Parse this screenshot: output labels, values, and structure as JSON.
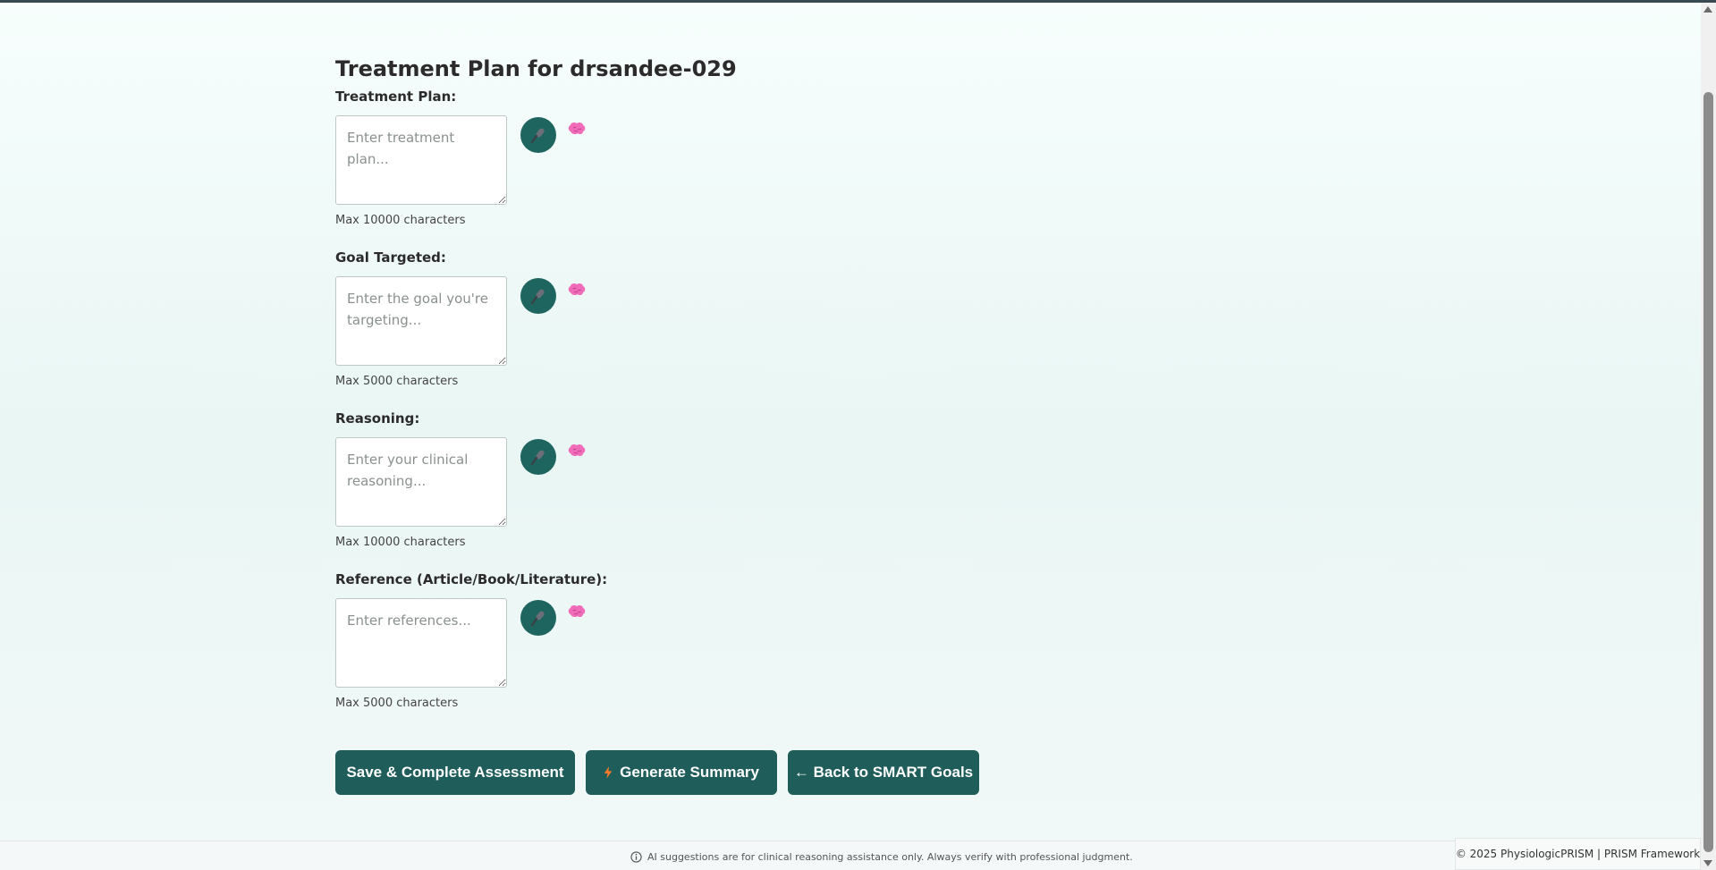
{
  "page": {
    "title": "Treatment Plan for drsandee-029"
  },
  "fields": [
    {
      "label": "Treatment Plan:",
      "placeholder": "Enter treatment plan...",
      "value": "",
      "hint": "Max 10000 characters"
    },
    {
      "label": "Goal Targeted:",
      "placeholder": "Enter the goal you're targeting...",
      "value": "",
      "hint": "Max 5000 characters"
    },
    {
      "label": "Reasoning:",
      "placeholder": "Enter your clinical reasoning...",
      "value": "",
      "hint": "Max 10000 characters"
    },
    {
      "label": "Reference (Article/Book/Literature):",
      "placeholder": "Enter references...",
      "value": "",
      "hint": "Max 5000 characters"
    }
  ],
  "icons": {
    "mic": "microphone-icon",
    "brain": "brain-icon",
    "lightning": "lightning-icon",
    "info": "info-icon"
  },
  "actions": {
    "save_label": "Save & Complete Assessment",
    "summary_label": "Generate Summary",
    "back_label": "← Back to SMART Goals"
  },
  "footer": {
    "disclaimer": "AI suggestions are for clinical reasoning assistance only. Always verify with professional judgment.",
    "copyright": "© 2025 PhysiologicPRISM | PRISM Framework"
  },
  "colors": {
    "primary": "#1e5d59",
    "mic_bg": "#1e6560",
    "brain": "#f06bb8",
    "lightning": "#ff7a2a"
  }
}
